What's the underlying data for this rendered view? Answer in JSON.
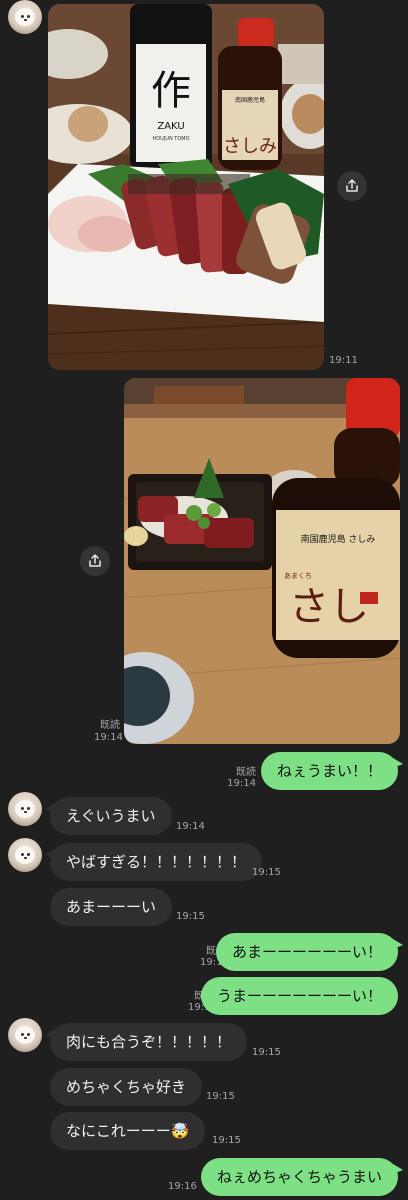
{
  "messages": [
    {
      "type": "image",
      "side": "in",
      "time": "19:11",
      "description": "photo-katsuo-tataki-plate"
    },
    {
      "type": "image",
      "side": "out",
      "status": "既読",
      "time": "19:14",
      "description": "photo-katsuo-and-soy-sauce"
    },
    {
      "type": "text",
      "side": "out",
      "text": "ねぇうまい！！",
      "status": "既読",
      "time": "19:14"
    },
    {
      "type": "text",
      "side": "in",
      "text": "えぐいうまい",
      "time": "19:14"
    },
    {
      "type": "text",
      "side": "in",
      "text": "やばすぎる！！！！！！！",
      "time": "19:15"
    },
    {
      "type": "text",
      "side": "in",
      "text": "あまーーーい",
      "time": "19:15"
    },
    {
      "type": "text",
      "side": "out",
      "text": "あまーーーーーーい！",
      "status": "既読",
      "time": "19:15"
    },
    {
      "type": "text",
      "side": "out",
      "text": "うまーーーーーーーい！",
      "status": "既読",
      "time": "19:15"
    },
    {
      "type": "text",
      "side": "in",
      "text": "肉にも合うぞ！！！！！",
      "time": "19:15"
    },
    {
      "type": "text",
      "side": "in",
      "text": "めちゃくちゃ好き",
      "time": "19:15"
    },
    {
      "type": "text",
      "side": "in",
      "text": "なにこれーーー🤯",
      "time": "19:15"
    },
    {
      "type": "text",
      "side": "out",
      "text": "ねぇめちゃくちゃうまい",
      "time": "19:16"
    }
  ],
  "photo1": {
    "bottle_brand": "作",
    "bottle_sub": "ZAKU",
    "bottle_small": "HOUJUN TOMO",
    "soy_label": "さしみ",
    "soy_top": "南国鹿児島"
  },
  "photo2": {
    "soy_top": "南国鹿児島 さしみ",
    "soy_label": "さし",
    "soy_small": "あまくち"
  },
  "colors": {
    "background": "#1f1f1f",
    "incoming_bubble": "#2f2f2f",
    "outgoing_bubble": "#7ee084",
    "meta_text": "#a6a6a6"
  }
}
